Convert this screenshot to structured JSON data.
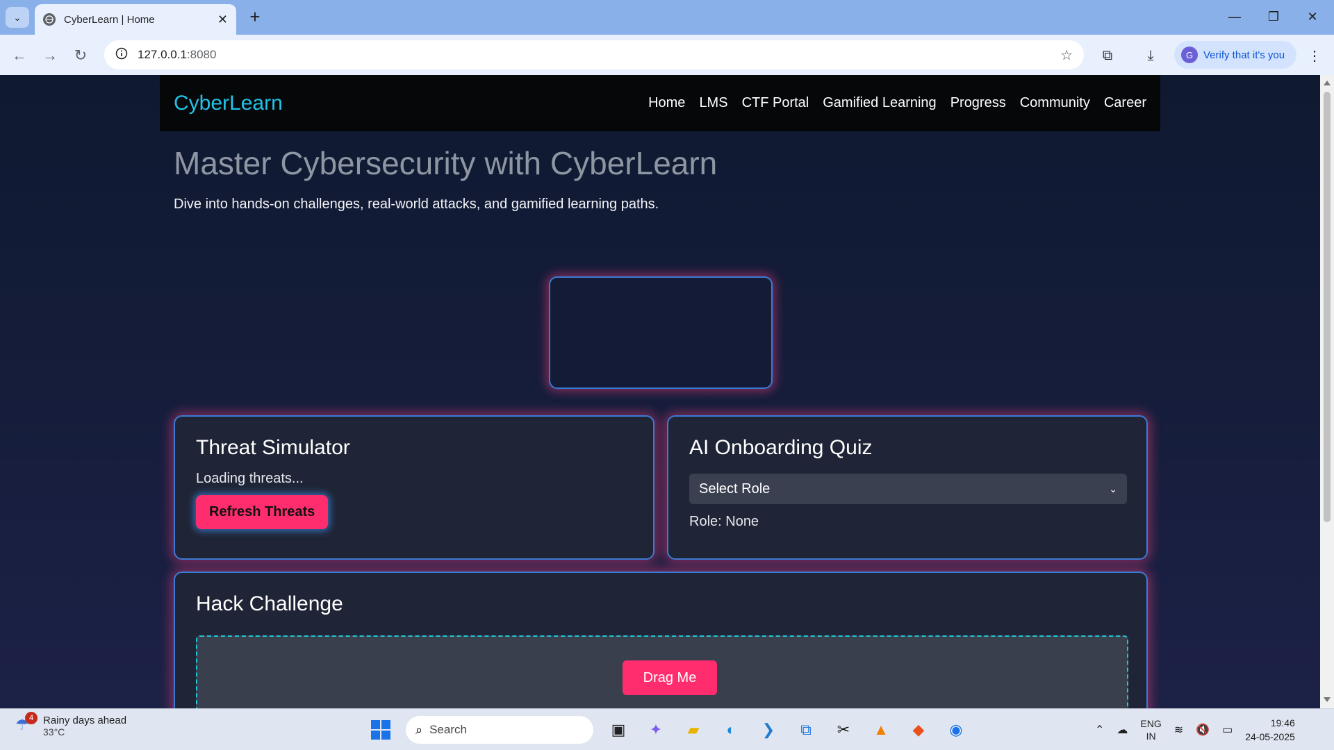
{
  "browser": {
    "tab_title": "CyberLearn | Home",
    "tab_close": "✕",
    "new_tab": "+",
    "url_host": "127.0.0.1",
    "url_port": ":8080",
    "verify_label": "Verify that it's you",
    "profile_initial": "G"
  },
  "site": {
    "brand": "CyberLearn",
    "nav": [
      "Home",
      "LMS",
      "CTF Portal",
      "Gamified Learning",
      "Progress",
      "Community",
      "Career"
    ],
    "hero_title": "Master Cybersecurity with CyberLearn",
    "hero_subtitle": "Dive into hands-on challenges, real-world attacks, and gamified learning paths."
  },
  "threat_card": {
    "title": "Threat Simulator",
    "status": "Loading threats...",
    "button": "Refresh Threats"
  },
  "quiz_card": {
    "title": "AI Onboarding Quiz",
    "select_value": "Select Role",
    "role_text": "Role: None"
  },
  "hack_card": {
    "title": "Hack Challenge",
    "drag_button": "Drag Me"
  },
  "taskbar": {
    "weather_title": "Rainy days ahead",
    "weather_temp": "33°C",
    "weather_badge": "4",
    "search_label": "Search",
    "lang_1": "ENG",
    "lang_2": "IN",
    "time": "19:46",
    "date": "24-05-2025"
  },
  "colors": {
    "accent_pink": "#ff2d6d",
    "accent_cyan": "#22c3e6",
    "card_border": "#3a7bd5"
  }
}
